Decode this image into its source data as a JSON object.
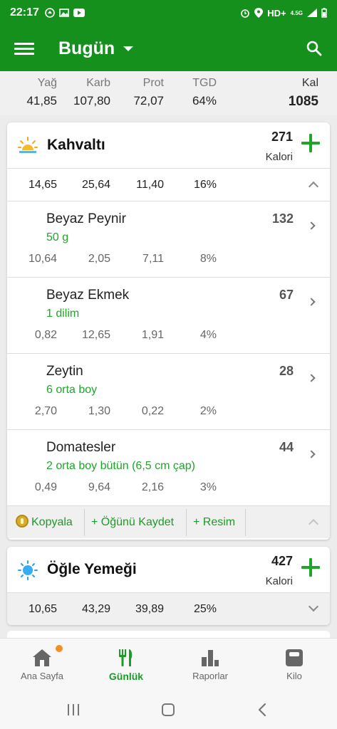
{
  "status_bar": {
    "time": "22:17",
    "network": "HD+",
    "network_sub": "4.5G"
  },
  "app_bar": {
    "title": "Bugün"
  },
  "summary": {
    "labels": {
      "fat": "Yağ",
      "carb": "Karb",
      "prot": "Prot",
      "tgd": "TGD",
      "kal": "Kal"
    },
    "values": {
      "fat": "41,85",
      "carb": "107,80",
      "prot": "72,07",
      "tgd": "64%",
      "kal": "1085"
    }
  },
  "meals": [
    {
      "title": "Kahvaltı",
      "calories": "271",
      "calories_label": "Kalori",
      "macros": {
        "fat": "14,65",
        "carb": "25,64",
        "prot": "11,40",
        "tgd": "16%"
      },
      "foods": [
        {
          "name": "Beyaz Peynir",
          "portion": "50 g",
          "calories": "132",
          "fat": "10,64",
          "carb": "2,05",
          "prot": "7,11",
          "tgd": "8%"
        },
        {
          "name": "Beyaz Ekmek",
          "portion": "1 dilim",
          "calories": "67",
          "fat": "0,82",
          "carb": "12,65",
          "prot": "1,91",
          "tgd": "4%"
        },
        {
          "name": "Zeytin",
          "portion": "6 orta boy",
          "calories": "28",
          "fat": "2,70",
          "carb": "1,30",
          "prot": "0,22",
          "tgd": "2%"
        },
        {
          "name": "Domatesler",
          "portion": "2 orta boy bütün (6,5 cm çap)",
          "calories": "44",
          "fat": "0,49",
          "carb": "9,64",
          "prot": "2,16",
          "tgd": "3%"
        }
      ],
      "actions": {
        "copy": "Kopyala",
        "save_meal": "+ Öğünü Kaydet",
        "photo": "+ Resim"
      }
    },
    {
      "title": "Öğle Yemeği",
      "calories": "427",
      "calories_label": "Kalori",
      "macros": {
        "fat": "10,65",
        "carb": "43,29",
        "prot": "39,89",
        "tgd": "25%"
      }
    }
  ],
  "bottom_nav": [
    {
      "label": "Ana Sayfa",
      "icon": "home-icon",
      "active": false
    },
    {
      "label": "Günlük",
      "icon": "cutlery-icon",
      "active": true
    },
    {
      "label": "Raporlar",
      "icon": "bar-chart-icon",
      "active": false
    },
    {
      "label": "Kilo",
      "icon": "scale-icon",
      "active": false
    }
  ],
  "colors": {
    "primary": "#15901c",
    "accent_green": "#1ea52a",
    "badge_orange": "#f3901e",
    "background": "#ececec"
  }
}
